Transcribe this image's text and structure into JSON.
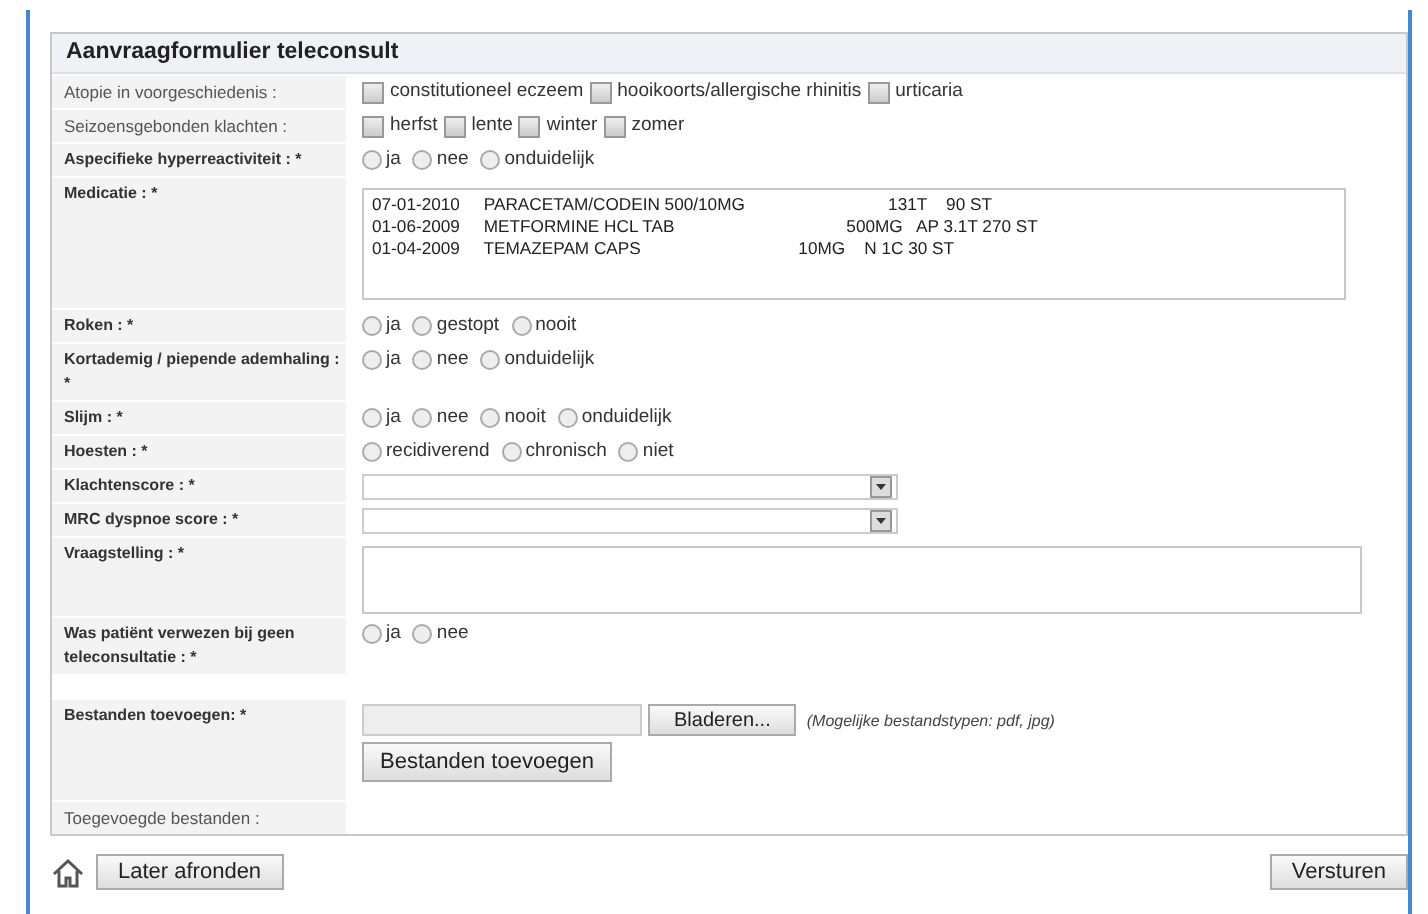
{
  "form": {
    "title": "Aanvraagformulier teleconsult",
    "rows": [
      {
        "kind": "checkboxes",
        "label": "Atopie in voorgeschiedenis :",
        "required": false,
        "options": [
          {
            "label": "constitutioneel eczeem",
            "checked": false
          },
          {
            "label": "hooikoorts/allergische rhinitis",
            "checked": false
          },
          {
            "label": "urticaria",
            "checked": false
          }
        ]
      },
      {
        "kind": "checkboxes",
        "label": "Seizoensgebonden klachten :",
        "required": false,
        "options": [
          {
            "label": "herfst",
            "checked": false
          },
          {
            "label": "lente",
            "checked": false
          },
          {
            "label": "winter",
            "checked": false
          },
          {
            "label": "zomer",
            "checked": false
          }
        ]
      },
      {
        "kind": "radios",
        "label": "Aspecifieke hyperreactiviteit : *",
        "required": true,
        "options": [
          {
            "label": "ja",
            "selected": false
          },
          {
            "label": "nee",
            "selected": false
          },
          {
            "label": "onduidelijk",
            "selected": false
          }
        ]
      },
      {
        "kind": "textarea",
        "label": "Medicatie : *",
        "required": true,
        "value": "07-01-2010     PARACETAM/CODEIN 500/10MG                              131T    90 ST\n01-06-2009     METFORMINE HCL TAB                                    500MG   AP 3.1T 270 ST\n01-04-2009     TEMAZEPAM CAPS                                 10MG    N 1C 30 ST"
      },
      {
        "kind": "radios",
        "label": "Roken : *",
        "required": true,
        "options": [
          {
            "label": "ja",
            "selected": false
          },
          {
            "label": "gestopt",
            "selected": false
          },
          {
            "label": "nooit",
            "selected": false
          }
        ]
      },
      {
        "kind": "radios",
        "label": "Kortademig / piepende ademhaling : *",
        "required": true,
        "options": [
          {
            "label": "ja",
            "selected": false
          },
          {
            "label": "nee",
            "selected": false
          },
          {
            "label": "onduidelijk",
            "selected": false
          }
        ]
      },
      {
        "kind": "radios",
        "label": "Slijm : *",
        "required": true,
        "options": [
          {
            "label": "ja",
            "selected": false
          },
          {
            "label": "nee",
            "selected": false
          },
          {
            "label": "nooit",
            "selected": false
          },
          {
            "label": "onduidelijk",
            "selected": false
          }
        ]
      },
      {
        "kind": "radios",
        "label": "Hoesten : *",
        "required": true,
        "options": [
          {
            "label": "recidiverend",
            "selected": false
          },
          {
            "label": "chronisch",
            "selected": false
          },
          {
            "label": "niet",
            "selected": false
          }
        ]
      },
      {
        "kind": "select",
        "label": "Klachtenscore : *",
        "required": true
      },
      {
        "kind": "select",
        "label": "MRC dyspnoe score : *",
        "required": true
      },
      {
        "kind": "question",
        "label": "Vraagstelling : *",
        "required": true
      },
      {
        "kind": "radios",
        "label": "Was patiënt verwezen bij geen teleconsultatie : *",
        "required": true,
        "options": [
          {
            "label": "ja",
            "selected": false
          },
          {
            "label": "nee",
            "selected": false
          }
        ]
      },
      {
        "kind": "file",
        "label": "Bestanden toevoegen: *",
        "required": true,
        "browse": "Bladeren...",
        "hint": "(Mogelijke bestandstypen: pdf, jpg)",
        "add": "Bestanden toevoegen"
      },
      {
        "kind": "empty",
        "label": "Toegevoegde bestanden :",
        "required": false
      }
    ]
  },
  "footer": {
    "later": "Later afronden",
    "send": "Versturen"
  }
}
